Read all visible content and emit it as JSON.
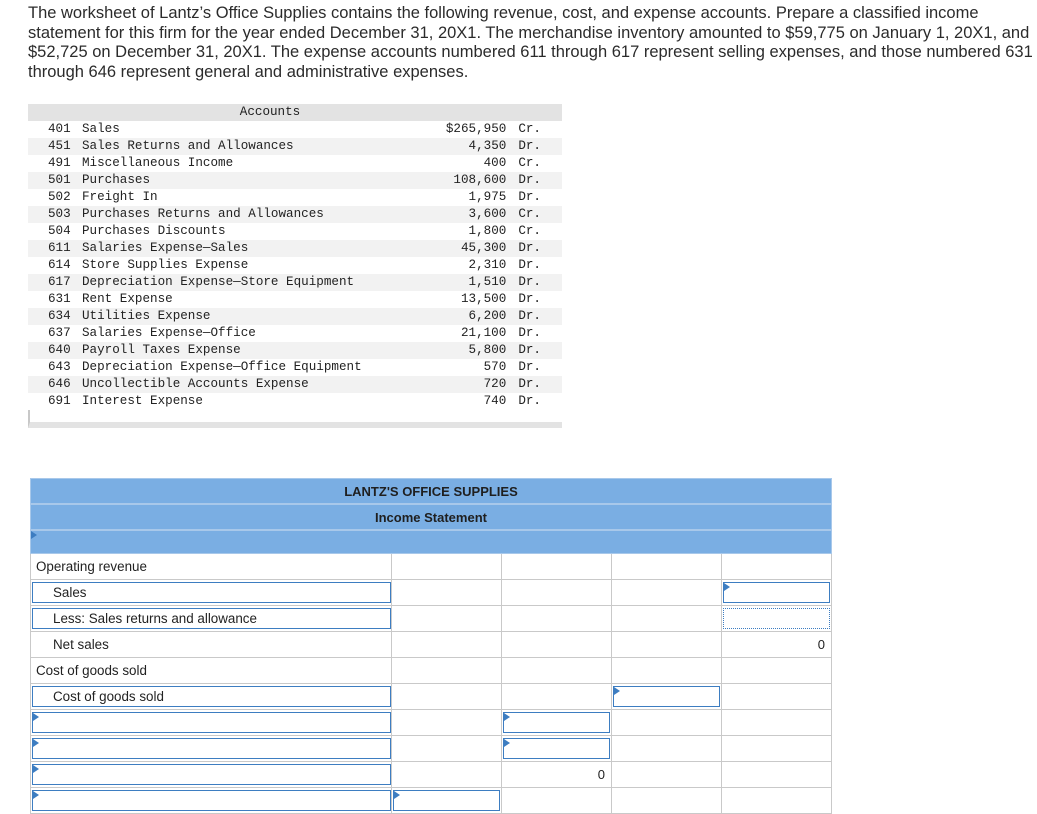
{
  "intro": "The worksheet of Lantz’s Office Supplies contains the following revenue, cost, and expense accounts. Prepare a classified income statement for this firm for the year ended December 31, 20X1. The merchandise inventory amounted to $59,775 on January 1, 20X1, and $52,725 on December 31, 20X1. The expense accounts numbered 611 through 617 represent selling expenses, and those numbered 631 through 646 represent general and administrative expenses.",
  "accounts_header": "Accounts",
  "accounts": [
    {
      "num": "401",
      "name": "Sales",
      "amount": "$265,950",
      "side": "Cr."
    },
    {
      "num": "451",
      "name": "Sales Returns and Allowances",
      "amount": "4,350",
      "side": "Dr."
    },
    {
      "num": "491",
      "name": "Miscellaneous Income",
      "amount": "400",
      "side": "Cr."
    },
    {
      "num": "501",
      "name": "Purchases",
      "amount": "108,600",
      "side": "Dr."
    },
    {
      "num": "502",
      "name": "Freight In",
      "amount": "1,975",
      "side": "Dr."
    },
    {
      "num": "503",
      "name": "Purchases Returns and Allowances",
      "amount": "3,600",
      "side": "Cr."
    },
    {
      "num": "504",
      "name": "Purchases Discounts",
      "amount": "1,800",
      "side": "Cr."
    },
    {
      "num": "611",
      "name": "Salaries Expense—Sales",
      "amount": "45,300",
      "side": "Dr."
    },
    {
      "num": "614",
      "name": "Store Supplies Expense",
      "amount": "2,310",
      "side": "Dr."
    },
    {
      "num": "617",
      "name": "Depreciation Expense—Store Equipment",
      "amount": "1,510",
      "side": "Dr."
    },
    {
      "num": "631",
      "name": "Rent Expense",
      "amount": "13,500",
      "side": "Dr."
    },
    {
      "num": "634",
      "name": "Utilities Expense",
      "amount": "6,200",
      "side": "Dr."
    },
    {
      "num": "637",
      "name": "Salaries Expense—Office",
      "amount": "21,100",
      "side": "Dr."
    },
    {
      "num": "640",
      "name": "Payroll Taxes Expense",
      "amount": "5,800",
      "side": "Dr."
    },
    {
      "num": "643",
      "name": "Depreciation Expense—Office Equipment",
      "amount": "570",
      "side": "Dr."
    },
    {
      "num": "646",
      "name": "Uncollectible Accounts Expense",
      "amount": "720",
      "side": "Dr."
    },
    {
      "num": "691",
      "name": "Interest Expense",
      "amount": "740",
      "side": "Dr."
    }
  ],
  "statement": {
    "company": "LANTZ'S OFFICE SUPPLIES",
    "title": "Income Statement",
    "rows": {
      "operating_revenue": "Operating revenue",
      "sales": "Sales",
      "less_returns": "Less: Sales returns and allowance",
      "net_sales": "Net sales",
      "net_sales_value": "0",
      "cogs_heading": "Cost of goods sold",
      "cogs": "Cost of goods sold",
      "subtotal_value": "0"
    }
  }
}
